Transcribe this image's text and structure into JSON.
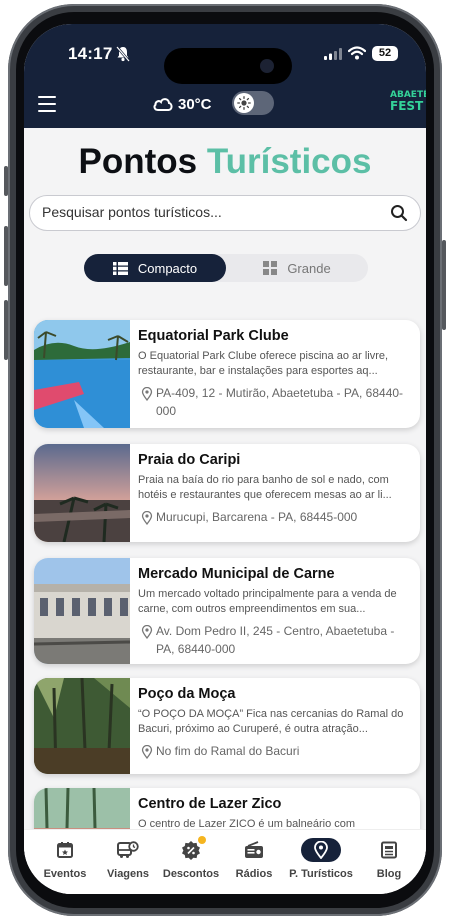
{
  "status": {
    "time": "14:17",
    "battery": "52"
  },
  "header": {
    "temperature": "30°C",
    "logo_line1": "ABAETÉ",
    "logo_line2": "FEST"
  },
  "page": {
    "title_part1": "Pontos",
    "title_part2": "Turísticos"
  },
  "search": {
    "placeholder": "Pesquisar pontos turísticos..."
  },
  "view_toggle": {
    "compact_label": "Compacto",
    "large_label": "Grande"
  },
  "places": [
    {
      "name": "Equatorial Park Clube",
      "description": "O Equatorial Park Clube oferece piscina ao ar livre, restaurante, bar e instalações para esportes aq...",
      "address": "PA-409, 12 - Mutirão, Abaetetuba - PA, 68440-000"
    },
    {
      "name": "Praia do Caripi",
      "description": "Praia na baía do rio para banho de sol e nado, com hotéis e restaurantes que oferecem mesas ao ar li...",
      "address": "Murucupi, Barcarena - PA, 68445-000"
    },
    {
      "name": "Mercado Municipal de Carne",
      "description": "Um mercado voltado principalmente para a venda de carne, com outros empreendimentos em sua...",
      "address": "Av. Dom Pedro II, 245 - Centro, Abaetetuba - PA, 68440-000"
    },
    {
      "name": "Poço da Moça",
      "description": "“O POÇO DA MOÇA” Fica nas cercanias do Ramal do Bacuri, próximo ao Curuperé, é outra atração...",
      "address": "No fim do Ramal do Bacuri"
    },
    {
      "name": "Centro de Lazer Zico",
      "description": "O centro de Lazer ZICO é um balneário com",
      "address": ""
    }
  ],
  "tabs": [
    {
      "label": "Eventos",
      "icon": "calendar-icon"
    },
    {
      "label": "Viagens",
      "icon": "bus-icon"
    },
    {
      "label": "Descontos",
      "icon": "discount-badge-icon"
    },
    {
      "label": "Rádios",
      "icon": "radio-icon"
    },
    {
      "label": "P. Turísticos",
      "icon": "location-pin-icon",
      "active": true
    },
    {
      "label": "Blog",
      "icon": "newspaper-icon"
    }
  ],
  "colors": {
    "navy": "#16223a",
    "accent": "#5cbfa6",
    "logo_green": "#34d399",
    "badge": "#f5b520"
  }
}
